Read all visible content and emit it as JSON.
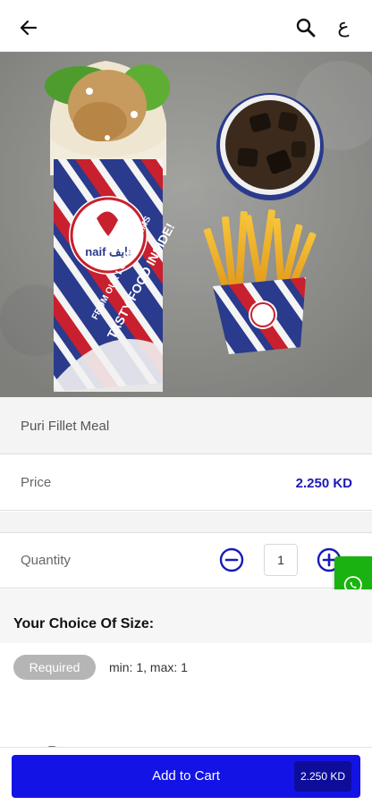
{
  "header": {
    "lang_toggle": "ع"
  },
  "product": {
    "name": "Puri Fillet Meal",
    "price_label": "Price",
    "price_value": "2.250 KD",
    "brand_wordmark": "naif نايف",
    "packaging_text": [
      "FROM OUR LOCAL FARMS",
      "TASTY FOOD INSIDE!"
    ]
  },
  "quantity": {
    "label": "Quantity",
    "value": "1"
  },
  "options": {
    "title": "Your Choice Of Size:",
    "required_label": "Required",
    "constraint": "min: 1, max: 1"
  },
  "cart": {
    "button_label": "Add to Cart",
    "total": "2.250 KD"
  },
  "colors": {
    "accent": "#1313e6",
    "accent_dark": "#0d0d9a",
    "price_text": "#1a1ab8",
    "whatsapp": "#19b210",
    "required_badge": "#b5b5b5"
  },
  "icons": [
    "arrow-left-icon",
    "search-icon",
    "minus-circle-icon",
    "plus-circle-icon",
    "whatsapp-icon"
  ]
}
